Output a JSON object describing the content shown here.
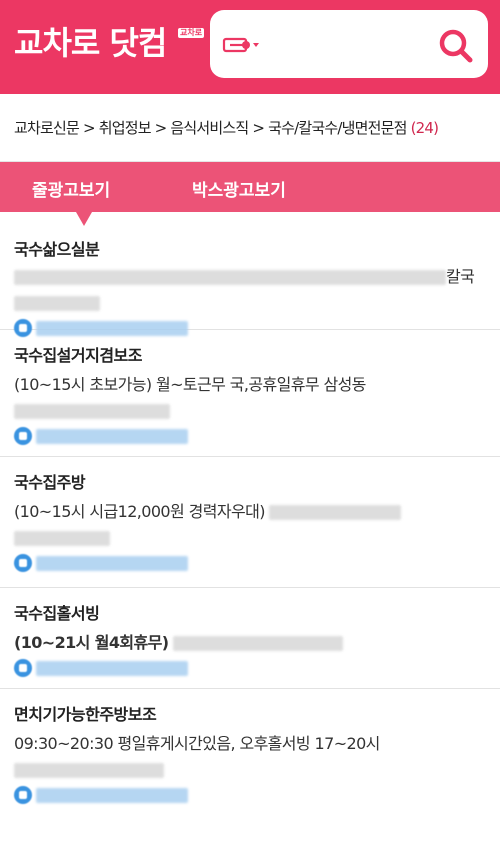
{
  "header": {
    "logo": "교차로 닷컴",
    "badge": "교차로",
    "search": {
      "placeholder": "",
      "category_icon": "category-dropdown-icon",
      "search_icon": "search-icon"
    }
  },
  "breadcrumb": {
    "path": "교차로신문 > 취업정보 > 음식서비스직 > 국수/칼국수/냉면전문점",
    "count": "(24)"
  },
  "tabs": [
    {
      "label": "줄광고보기"
    },
    {
      "label": "박스광고보기"
    }
  ],
  "listings": [
    {
      "title": "국수삶으실분",
      "desc": "",
      "desc_end": "칼국"
    },
    {
      "title": "국수집설거지겸보조",
      "desc": "(10~15시 초보가능) 월~토근무 국,공휴일휴무 삼성동"
    },
    {
      "title": "국수집주방",
      "desc": "(10~15시 시급12,000원 경력자우대)"
    },
    {
      "title": "국수집홀서빙",
      "desc": "(10~21시 월4회휴무)"
    },
    {
      "title": "면치기가능한주방보조",
      "desc": "09:30~20:30 평일휴게시간있음, 오후홀서빙 17~20시"
    }
  ],
  "colors": {
    "brand": "#ec3763",
    "tab_bg": "#ec5377",
    "count": "#d0284f",
    "phone": "#3a93e0"
  }
}
